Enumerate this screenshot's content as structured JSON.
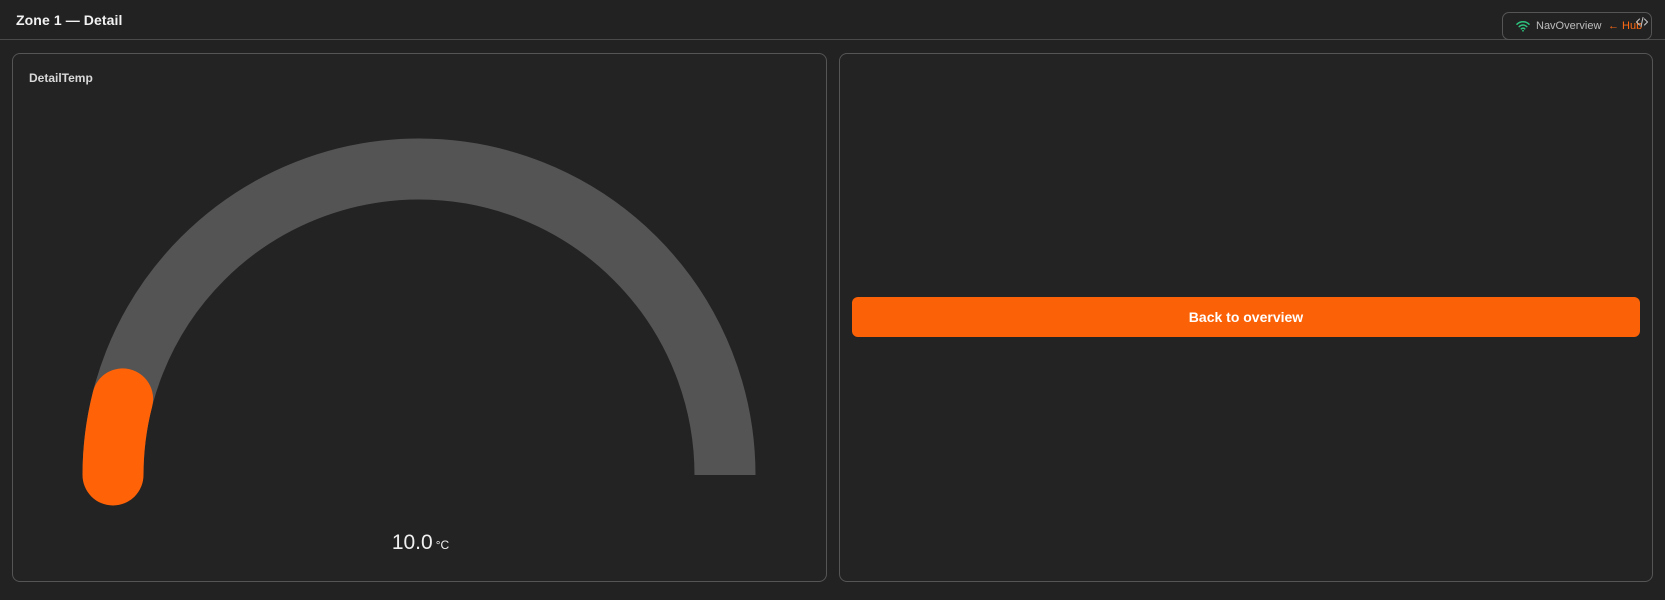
{
  "header": {
    "title": "Zone 1 — Detail"
  },
  "nav": {
    "status_label": "NavOverview",
    "hub_link": "← Hub",
    "wifi_icon": "wifi-icon",
    "code_icon": "code-icon"
  },
  "gauge_card": {
    "title": "DetailTemp",
    "value": "10.0",
    "unit": "°C",
    "fraction": 0.08,
    "track_color": "#545454",
    "fill_color": "#ff6207"
  },
  "action_card": {
    "back_label": "Back to overview"
  },
  "colors": {
    "background": "#222222",
    "accent": "#fb6207",
    "wifi": "#2ec27e",
    "border": "#555555"
  }
}
